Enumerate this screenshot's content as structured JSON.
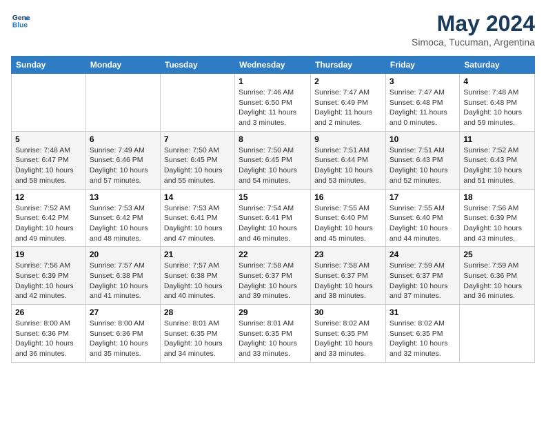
{
  "header": {
    "logo_general": "General",
    "logo_blue": "Blue",
    "month": "May 2024",
    "location": "Simoca, Tucuman, Argentina"
  },
  "weekdays": [
    "Sunday",
    "Monday",
    "Tuesday",
    "Wednesday",
    "Thursday",
    "Friday",
    "Saturday"
  ],
  "weeks": [
    [
      {
        "day": "",
        "info": ""
      },
      {
        "day": "",
        "info": ""
      },
      {
        "day": "",
        "info": ""
      },
      {
        "day": "1",
        "info": "Sunrise: 7:46 AM\nSunset: 6:50 PM\nDaylight: 11 hours\nand 3 minutes."
      },
      {
        "day": "2",
        "info": "Sunrise: 7:47 AM\nSunset: 6:49 PM\nDaylight: 11 hours\nand 2 minutes."
      },
      {
        "day": "3",
        "info": "Sunrise: 7:47 AM\nSunset: 6:48 PM\nDaylight: 11 hours\nand 0 minutes."
      },
      {
        "day": "4",
        "info": "Sunrise: 7:48 AM\nSunset: 6:48 PM\nDaylight: 10 hours\nand 59 minutes."
      }
    ],
    [
      {
        "day": "5",
        "info": "Sunrise: 7:48 AM\nSunset: 6:47 PM\nDaylight: 10 hours\nand 58 minutes."
      },
      {
        "day": "6",
        "info": "Sunrise: 7:49 AM\nSunset: 6:46 PM\nDaylight: 10 hours\nand 57 minutes."
      },
      {
        "day": "7",
        "info": "Sunrise: 7:50 AM\nSunset: 6:45 PM\nDaylight: 10 hours\nand 55 minutes."
      },
      {
        "day": "8",
        "info": "Sunrise: 7:50 AM\nSunset: 6:45 PM\nDaylight: 10 hours\nand 54 minutes."
      },
      {
        "day": "9",
        "info": "Sunrise: 7:51 AM\nSunset: 6:44 PM\nDaylight: 10 hours\nand 53 minutes."
      },
      {
        "day": "10",
        "info": "Sunrise: 7:51 AM\nSunset: 6:43 PM\nDaylight: 10 hours\nand 52 minutes."
      },
      {
        "day": "11",
        "info": "Sunrise: 7:52 AM\nSunset: 6:43 PM\nDaylight: 10 hours\nand 51 minutes."
      }
    ],
    [
      {
        "day": "12",
        "info": "Sunrise: 7:52 AM\nSunset: 6:42 PM\nDaylight: 10 hours\nand 49 minutes."
      },
      {
        "day": "13",
        "info": "Sunrise: 7:53 AM\nSunset: 6:42 PM\nDaylight: 10 hours\nand 48 minutes."
      },
      {
        "day": "14",
        "info": "Sunrise: 7:53 AM\nSunset: 6:41 PM\nDaylight: 10 hours\nand 47 minutes."
      },
      {
        "day": "15",
        "info": "Sunrise: 7:54 AM\nSunset: 6:41 PM\nDaylight: 10 hours\nand 46 minutes."
      },
      {
        "day": "16",
        "info": "Sunrise: 7:55 AM\nSunset: 6:40 PM\nDaylight: 10 hours\nand 45 minutes."
      },
      {
        "day": "17",
        "info": "Sunrise: 7:55 AM\nSunset: 6:40 PM\nDaylight: 10 hours\nand 44 minutes."
      },
      {
        "day": "18",
        "info": "Sunrise: 7:56 AM\nSunset: 6:39 PM\nDaylight: 10 hours\nand 43 minutes."
      }
    ],
    [
      {
        "day": "19",
        "info": "Sunrise: 7:56 AM\nSunset: 6:39 PM\nDaylight: 10 hours\nand 42 minutes."
      },
      {
        "day": "20",
        "info": "Sunrise: 7:57 AM\nSunset: 6:38 PM\nDaylight: 10 hours\nand 41 minutes."
      },
      {
        "day": "21",
        "info": "Sunrise: 7:57 AM\nSunset: 6:38 PM\nDaylight: 10 hours\nand 40 minutes."
      },
      {
        "day": "22",
        "info": "Sunrise: 7:58 AM\nSunset: 6:37 PM\nDaylight: 10 hours\nand 39 minutes."
      },
      {
        "day": "23",
        "info": "Sunrise: 7:58 AM\nSunset: 6:37 PM\nDaylight: 10 hours\nand 38 minutes."
      },
      {
        "day": "24",
        "info": "Sunrise: 7:59 AM\nSunset: 6:37 PM\nDaylight: 10 hours\nand 37 minutes."
      },
      {
        "day": "25",
        "info": "Sunrise: 7:59 AM\nSunset: 6:36 PM\nDaylight: 10 hours\nand 36 minutes."
      }
    ],
    [
      {
        "day": "26",
        "info": "Sunrise: 8:00 AM\nSunset: 6:36 PM\nDaylight: 10 hours\nand 36 minutes."
      },
      {
        "day": "27",
        "info": "Sunrise: 8:00 AM\nSunset: 6:36 PM\nDaylight: 10 hours\nand 35 minutes."
      },
      {
        "day": "28",
        "info": "Sunrise: 8:01 AM\nSunset: 6:35 PM\nDaylight: 10 hours\nand 34 minutes."
      },
      {
        "day": "29",
        "info": "Sunrise: 8:01 AM\nSunset: 6:35 PM\nDaylight: 10 hours\nand 33 minutes."
      },
      {
        "day": "30",
        "info": "Sunrise: 8:02 AM\nSunset: 6:35 PM\nDaylight: 10 hours\nand 33 minutes."
      },
      {
        "day": "31",
        "info": "Sunrise: 8:02 AM\nSunset: 6:35 PM\nDaylight: 10 hours\nand 32 minutes."
      },
      {
        "day": "",
        "info": ""
      }
    ]
  ]
}
